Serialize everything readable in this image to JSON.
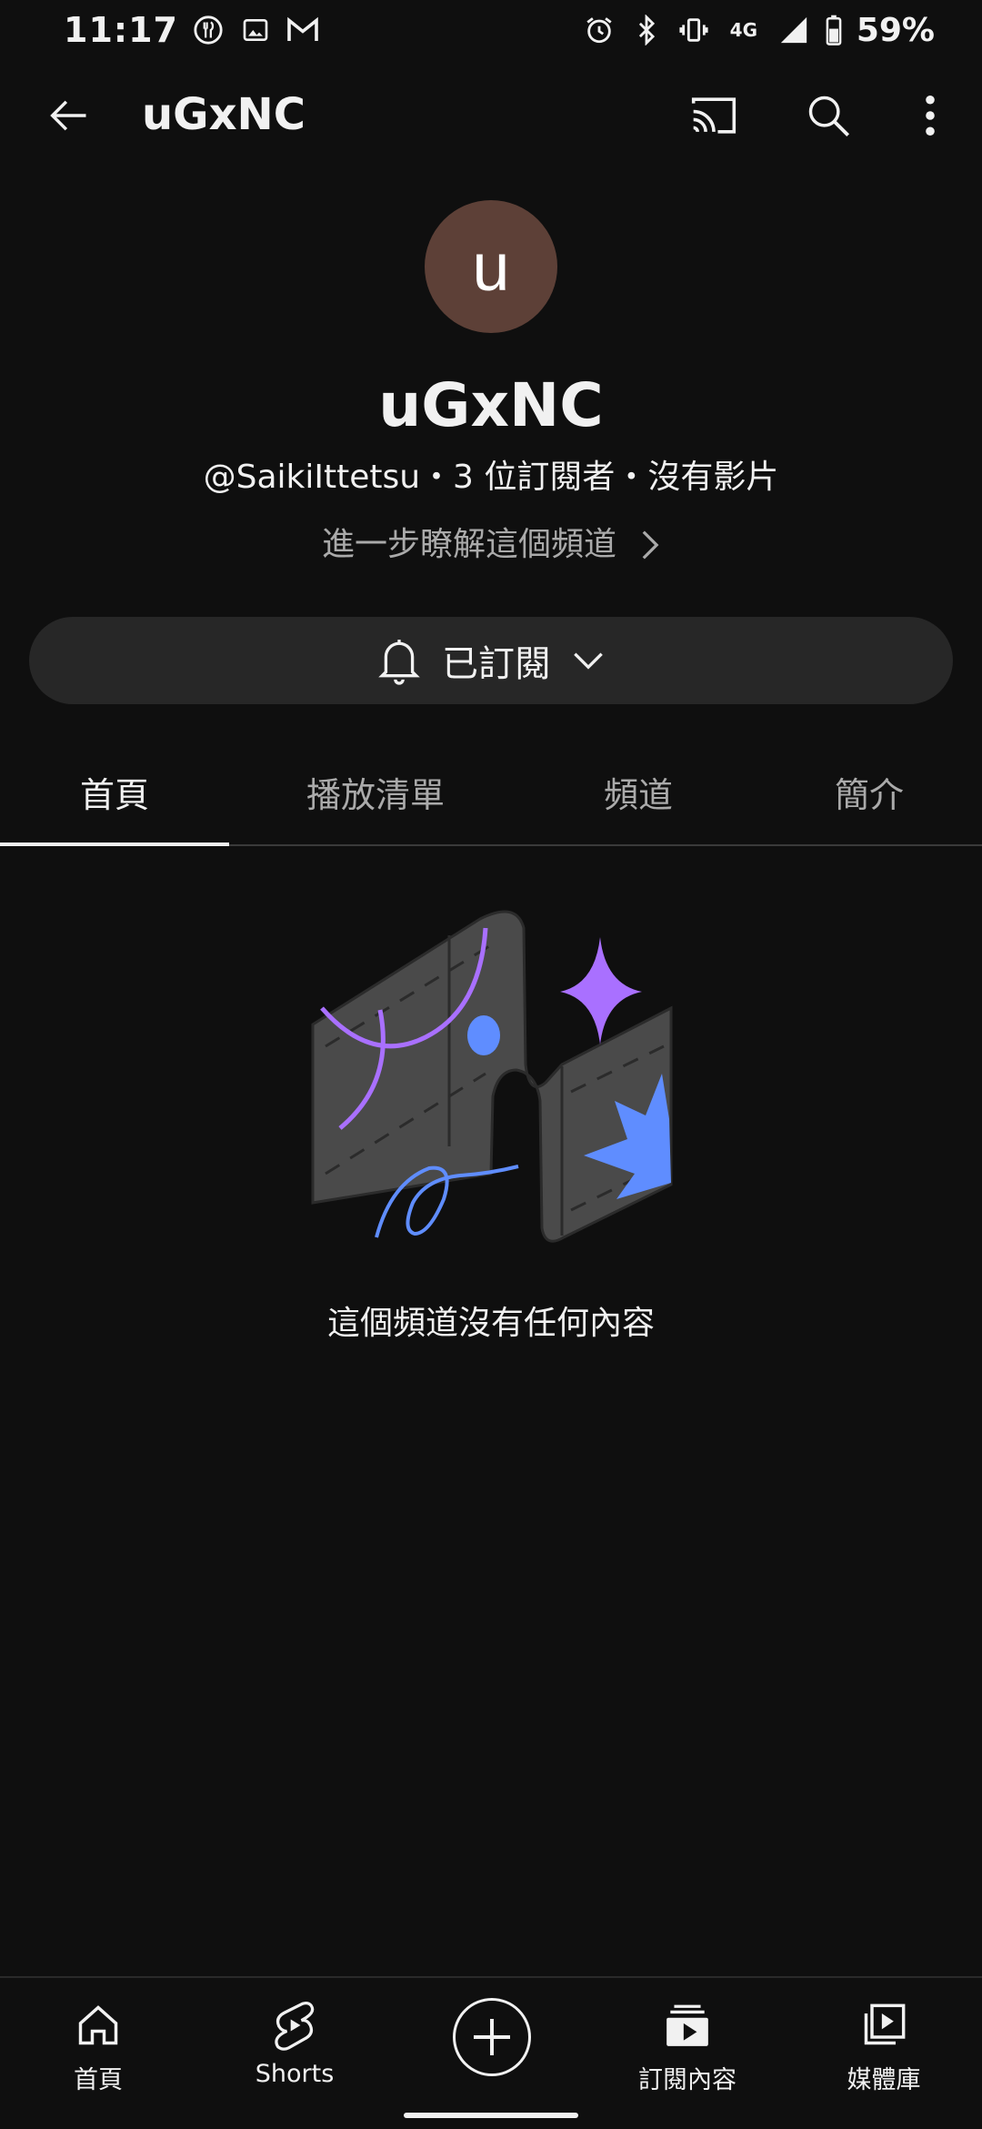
{
  "status_bar": {
    "time": "11:17",
    "battery": "59%",
    "network": "4G"
  },
  "app_bar": {
    "title": "uGxNC",
    "icons": [
      "back-arrow-icon",
      "cast-icon",
      "search-icon",
      "more-vert-icon"
    ]
  },
  "channel": {
    "avatar_letter": "u",
    "avatar_color": "#5d4037",
    "name": "uGxNC",
    "meta": "@SaikiIttetsu・3 位訂閱者・沒有影片",
    "more_link": "進一步瞭解這個頻道"
  },
  "subscribe": {
    "label": "已訂閱"
  },
  "tabs": [
    {
      "label": "首頁",
      "active": true
    },
    {
      "label": "播放清單",
      "active": false
    },
    {
      "label": "頻道",
      "active": false
    },
    {
      "label": "簡介",
      "active": false
    }
  ],
  "empty_state": {
    "message": "這個頻道沒有任何內容"
  },
  "bottom_nav": {
    "items": [
      {
        "label": "首頁",
        "icon": "home-icon"
      },
      {
        "label": "Shorts",
        "icon": "shorts-icon"
      },
      {
        "label": "",
        "icon": "create-plus-icon"
      },
      {
        "label": "訂閱內容",
        "icon": "subscriptions-icon"
      },
      {
        "label": "媒體庫",
        "icon": "library-icon"
      }
    ]
  },
  "colors": {
    "background": "#0f0f0f",
    "surface": "#272727",
    "text_primary": "#f1f1f1",
    "text_secondary": "#aaaaaa",
    "accent_purple": "#a970ff",
    "accent_blue": "#5f8dff"
  }
}
